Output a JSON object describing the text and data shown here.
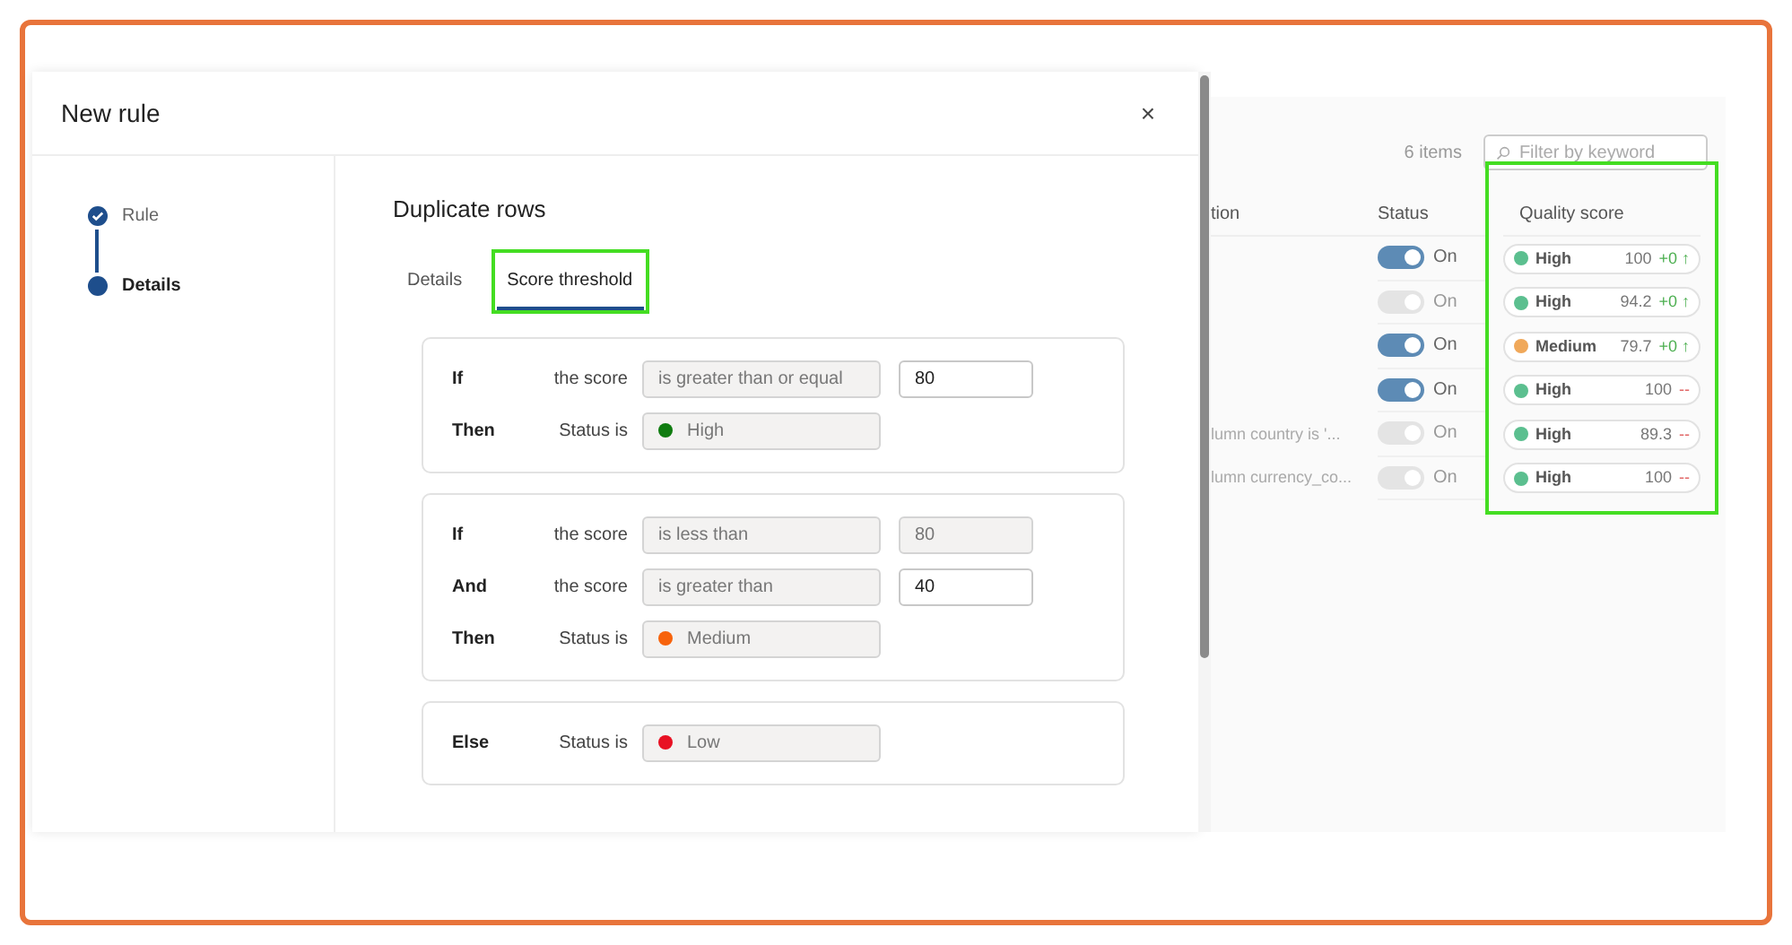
{
  "dialog": {
    "title": "New rule",
    "close": "×",
    "steps": [
      {
        "label": "Rule",
        "done": true,
        "selected": false
      },
      {
        "label": "Details",
        "done": false,
        "selected": true
      }
    ],
    "heading": "Duplicate rows",
    "tabs": [
      {
        "label": "Details",
        "selected": false,
        "highlighted": false
      },
      {
        "label": "Score threshold",
        "selected": true,
        "highlighted": true
      }
    ],
    "cards": [
      {
        "rows": [
          {
            "kind": "condition",
            "keyword": "If",
            "subject": "the score",
            "operator": "is greater than or equal",
            "value": "80",
            "value_editable": true
          },
          {
            "kind": "status",
            "keyword": "Then",
            "subject": "Status is",
            "status": "High",
            "color": "#107c10"
          }
        ]
      },
      {
        "rows": [
          {
            "kind": "condition",
            "keyword": "If",
            "subject": "the score",
            "operator": "is less than",
            "value": "80",
            "value_editable": false
          },
          {
            "kind": "condition",
            "keyword": "And",
            "subject": "the score",
            "operator": "is greater than",
            "value": "40",
            "value_editable": true
          },
          {
            "kind": "status",
            "keyword": "Then",
            "subject": "Status is",
            "status": "Medium",
            "color": "#f7630c"
          }
        ]
      },
      {
        "rows": [
          {
            "kind": "status",
            "keyword": "Else",
            "subject": "Status is",
            "status": "Low",
            "color": "#e81123"
          }
        ]
      }
    ]
  },
  "background_page": {
    "count": "6 items",
    "filter": {
      "placeholder": "Filter by keyword"
    },
    "columns": [
      {
        "label": "tion"
      },
      {
        "label": "Status"
      },
      {
        "label": "Quality score",
        "highlighted": true
      }
    ],
    "rows": [
      {
        "description": "",
        "toggle": "On",
        "disabled": false,
        "level": "High",
        "color": "#5bbf8f",
        "score": "100",
        "delta": {
          "text": "+0 ↑",
          "color": "#4caf50"
        }
      },
      {
        "description": "",
        "toggle": "On",
        "disabled": true,
        "level": "High",
        "color": "#5bbf8f",
        "score": "94.2",
        "delta": {
          "text": "+0 ↑",
          "color": "#4caf50"
        }
      },
      {
        "description": "",
        "toggle": "On",
        "disabled": false,
        "level": "Medium",
        "color": "#f0a85a",
        "score": "79.7",
        "delta": {
          "text": "+0 ↑",
          "color": "#4caf50"
        }
      },
      {
        "description": "",
        "toggle": "On",
        "disabled": false,
        "level": "High",
        "color": "#5bbf8f",
        "score": "100",
        "delta": {
          "text": "--",
          "color": "#e06060"
        }
      },
      {
        "description": "lumn country is '...",
        "toggle": "On",
        "disabled": true,
        "level": "High",
        "color": "#5bbf8f",
        "score": "89.3",
        "delta": {
          "text": "--",
          "color": "#e06060"
        }
      },
      {
        "description": "lumn currency_co...",
        "toggle": "On",
        "disabled": true,
        "level": "High",
        "color": "#5bbf8f",
        "score": "100",
        "delta": {
          "text": "--",
          "color": "#e06060"
        }
      }
    ]
  }
}
